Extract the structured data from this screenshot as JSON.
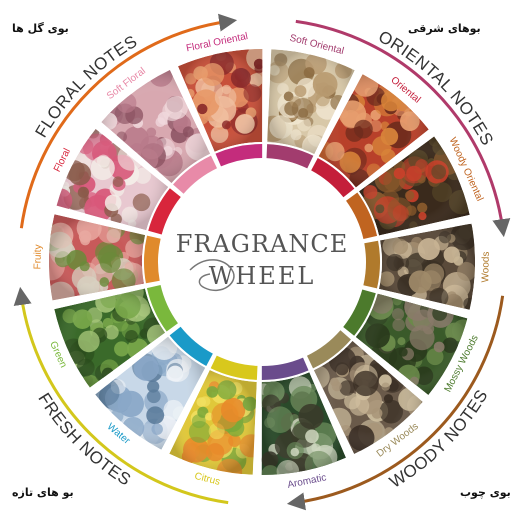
{
  "persian_labels": {
    "floral": "بوی گل ها",
    "oriental": "بوهای شرقی",
    "fresh": "بو های تازه",
    "woody": "بوی چوب"
  },
  "families": [
    {
      "name": "ORIENTAL NOTES",
      "arc_color": "#b03a6a"
    },
    {
      "name": "WOODY NOTES",
      "arc_color": "#9c5a1e"
    },
    {
      "name": "FRESH NOTES",
      "arc_color": "#d3c71c"
    },
    {
      "name": "FLORAL NOTES",
      "arc_color": "#e06a1a"
    }
  ],
  "center": {
    "line1": "FRAGRANCE",
    "line2": "WHEEL"
  },
  "segments": [
    {
      "name": "Soft Oriental",
      "color": "#a23c6e",
      "label_color": "#a23c6e"
    },
    {
      "name": "Oriental",
      "color": "#c41e3a",
      "label_color": "#c41e3a"
    },
    {
      "name": "Woody Oriental",
      "color": "#c06420",
      "label_color": "#c06420"
    },
    {
      "name": "Woods",
      "color": "#b07a2c",
      "label_color": "#b07a2c"
    },
    {
      "name": "Mossy Woods",
      "color": "#4c7a2c",
      "label_color": "#4c7a2c"
    },
    {
      "name": "Dry Woods",
      "color": "#9a8a5a",
      "label_color": "#9a8a5a"
    },
    {
      "name": "Aromatic",
      "color": "#6a4c8c",
      "label_color": "#6a4c8c"
    },
    {
      "name": "Citrus",
      "color": "#d8c81c",
      "label_color": "#d8c81c"
    },
    {
      "name": "Water",
      "color": "#1a9ac8",
      "label_color": "#1a9ac8"
    },
    {
      "name": "Green",
      "color": "#7ab83c",
      "label_color": "#7ab83c"
    },
    {
      "name": "Fruity",
      "color": "#e08a2c",
      "label_color": "#e08a2c"
    },
    {
      "name": "Floral",
      "color": "#d8263c",
      "label_color": "#d8263c"
    },
    {
      "name": "Soft Floral",
      "color": "#e88aa8",
      "label_color": "#e88aa8"
    },
    {
      "name": "Floral Oriental",
      "color": "#c42c7c",
      "label_color": "#c42c7c"
    }
  ]
}
